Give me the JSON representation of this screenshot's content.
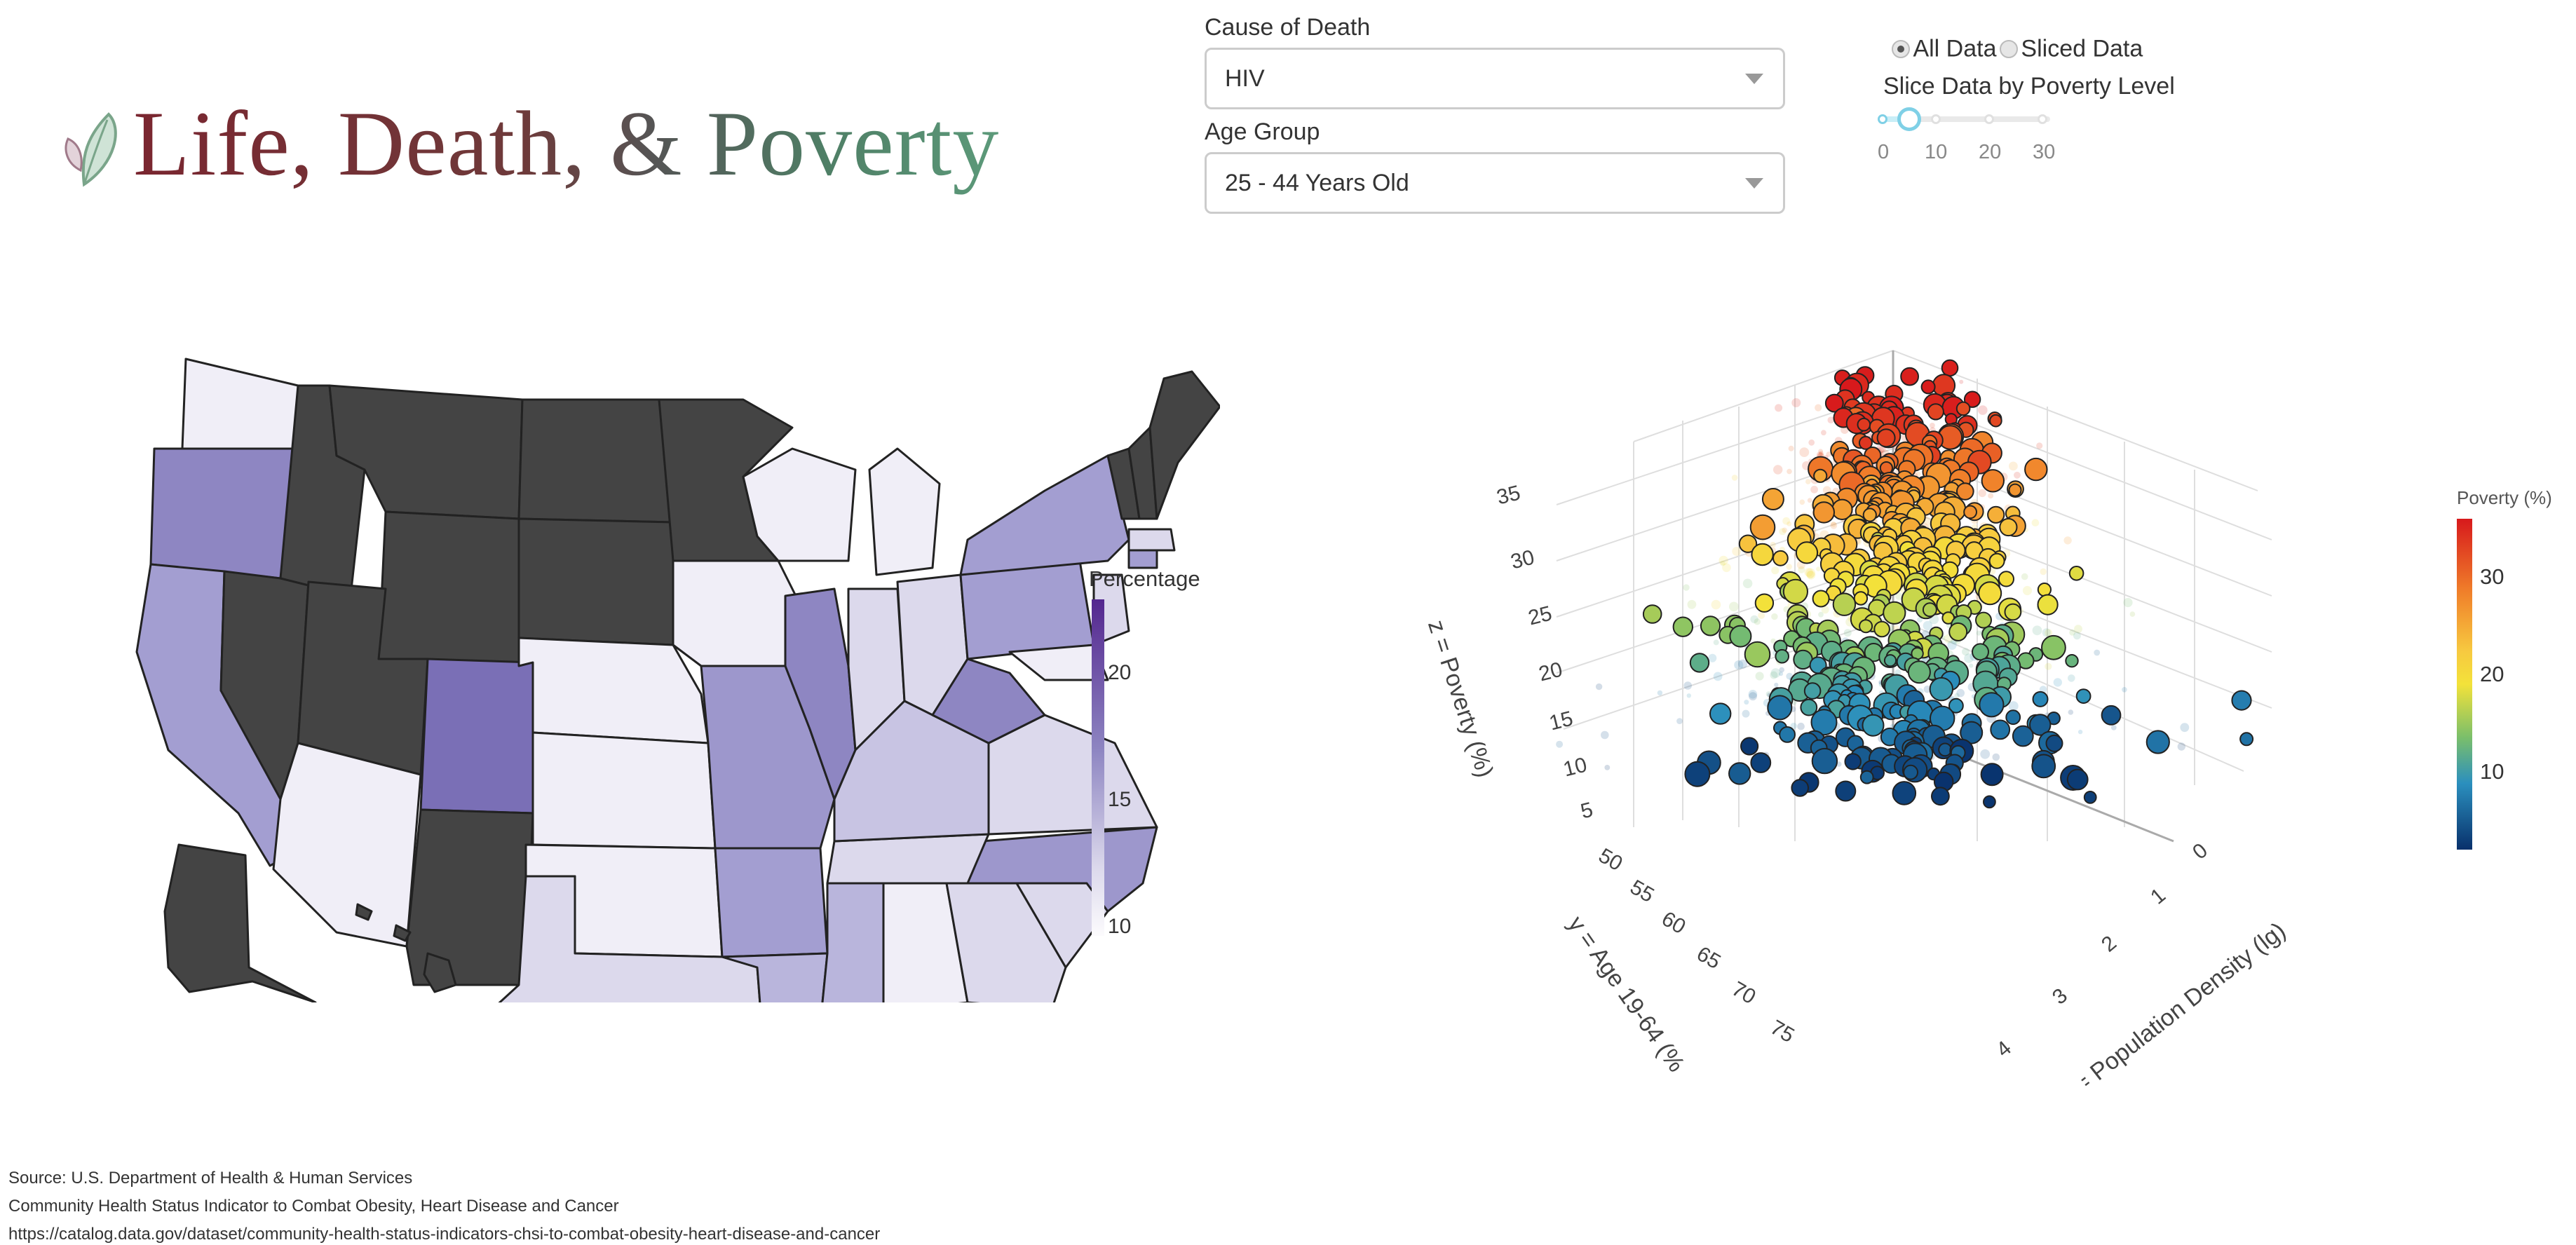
{
  "header": {
    "logo_text": "Life, Death, & Poverty"
  },
  "controls": {
    "cause": {
      "label": "Cause of Death",
      "value": "HIV"
    },
    "age": {
      "label": "Age Group",
      "value": "25 - 44 Years Old"
    },
    "radio": {
      "options": [
        "All Data",
        "Sliced Data"
      ],
      "selected": "All Data"
    },
    "slider": {
      "label": "Slice Data by Poverty Level",
      "marks": [
        "0",
        "10",
        "20",
        "30"
      ],
      "value": 5
    }
  },
  "map": {
    "colorbar": {
      "title": "Percentage",
      "ticks": [
        "20",
        "15",
        "10"
      ]
    },
    "colors": {
      "light": "#f0eef7",
      "mid": "#9d97cc",
      "dark": "#54278f",
      "nodata": "#444444"
    }
  },
  "scatter": {
    "colorbar": {
      "title": "Poverty (%)",
      "ticks": [
        "30",
        "20",
        "10"
      ]
    },
    "z_label": "z = Poverty (%)",
    "y_label": "y = Age 19-64 (%",
    "x_label": "x = Population Density (lg)",
    "z_ticks": [
      "35",
      "30",
      "25",
      "20",
      "15",
      "10",
      "5"
    ],
    "y_ticks": [
      "50",
      "55",
      "60",
      "65",
      "70",
      "75"
    ],
    "x_ticks": [
      "0",
      "1",
      "2",
      "3",
      "4"
    ]
  },
  "footer": {
    "source": "Source: U.S. Department of Health & Human Services",
    "dataset": "Community Health Status Indicator to Combat Obesity, Heart Disease and Cancer",
    "url": "https://catalog.data.gov/dataset/community-health-status-indicators-chsi-to-combat-obesity-heart-disease-and-cancer"
  }
}
